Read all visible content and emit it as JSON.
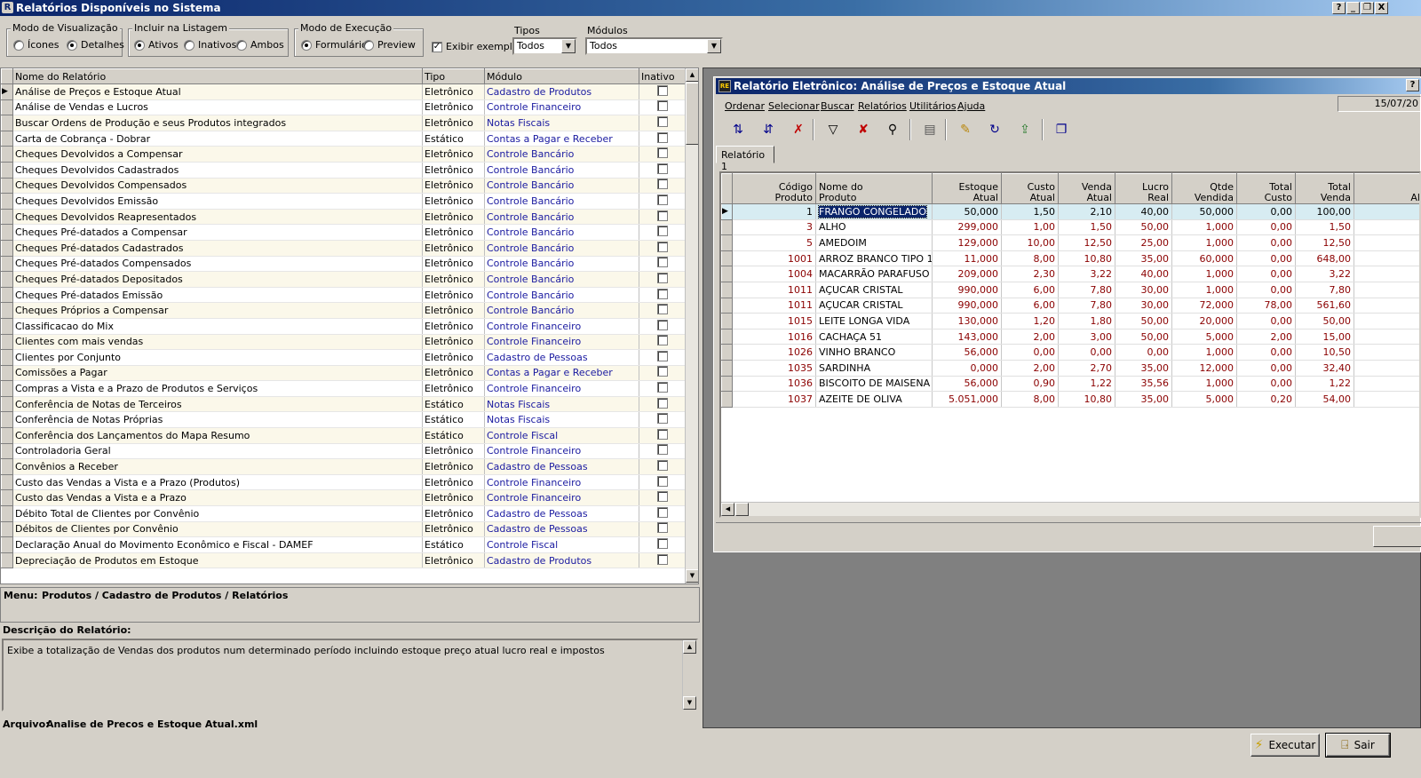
{
  "window": {
    "title": "Relatórios Disponíveis no Sistema",
    "buttons": [
      "?",
      "_",
      "❐",
      "X"
    ]
  },
  "toolbar": {
    "view_mode": {
      "label": "Modo de Visualização",
      "options": [
        "Ícones",
        "Detalhes"
      ],
      "selected": "Detalhes"
    },
    "include": {
      "label": "Incluir na Listagem",
      "options": [
        "Ativos",
        "Inativos",
        "Ambos"
      ],
      "selected": "Ativos"
    },
    "exec_mode": {
      "label": "Modo de Execução",
      "options": [
        "Formulário",
        "Preview"
      ],
      "selected": "Formulário"
    },
    "show_example": {
      "label": "Exibir exemplo",
      "checked": true
    },
    "types": {
      "label": "Tipos",
      "value": "Todos"
    },
    "modules": {
      "label": "Módulos",
      "value": "Todos"
    }
  },
  "report_list": {
    "columns": [
      "Nome do Relatório",
      "Tipo",
      "Módulo",
      "Inativo"
    ],
    "rows": [
      [
        "Análise de Preços e Estoque Atual",
        "Eletrônico",
        "Cadastro de Produtos"
      ],
      [
        "Análise de Vendas e Lucros",
        "Eletrônico",
        "Controle Financeiro"
      ],
      [
        "Buscar Ordens de Produção e seus Produtos integrados",
        "Eletrônico",
        "Notas Fiscais"
      ],
      [
        "Carta de Cobrança - Dobrar",
        "Estático",
        "Contas a Pagar e Receber"
      ],
      [
        "Cheques Devolvidos a Compensar",
        "Eletrônico",
        "Controle Bancário"
      ],
      [
        "Cheques Devolvidos Cadastrados",
        "Eletrônico",
        "Controle Bancário"
      ],
      [
        "Cheques Devolvidos Compensados",
        "Eletrônico",
        "Controle Bancário"
      ],
      [
        "Cheques Devolvidos Emissão",
        "Eletrônico",
        "Controle Bancário"
      ],
      [
        "Cheques Devolvidos Reapresentados",
        "Eletrônico",
        "Controle Bancário"
      ],
      [
        "Cheques Pré-datados a Compensar",
        "Eletrônico",
        "Controle Bancário"
      ],
      [
        "Cheques Pré-datados Cadastrados",
        "Eletrônico",
        "Controle Bancário"
      ],
      [
        "Cheques Pré-datados Compensados",
        "Eletrônico",
        "Controle Bancário"
      ],
      [
        "Cheques Pré-datados Depositados",
        "Eletrônico",
        "Controle Bancário"
      ],
      [
        "Cheques Pré-datados Emissão",
        "Eletrônico",
        "Controle Bancário"
      ],
      [
        "Cheques Próprios a Compensar",
        "Eletrônico",
        "Controle Bancário"
      ],
      [
        "Classificacao do Mix",
        "Eletrônico",
        "Controle Financeiro"
      ],
      [
        "Clientes com mais vendas",
        "Eletrônico",
        "Controle Financeiro"
      ],
      [
        "Clientes por Conjunto",
        "Eletrônico",
        "Cadastro de Pessoas"
      ],
      [
        "Comissões a Pagar",
        "Eletrônico",
        "Contas a Pagar e Receber"
      ],
      [
        "Compras a Vista e a Prazo de Produtos e Serviços",
        "Eletrônico",
        "Controle Financeiro"
      ],
      [
        "Conferência de Notas de Terceiros",
        "Estático",
        "Notas Fiscais"
      ],
      [
        "Conferência de Notas Próprias",
        "Estático",
        "Notas Fiscais"
      ],
      [
        "Conferência dos Lançamentos do Mapa Resumo",
        "Estático",
        "Controle Fiscal"
      ],
      [
        "Controladoria Geral",
        "Eletrônico",
        "Controle Financeiro"
      ],
      [
        "Convênios a Receber",
        "Eletrônico",
        "Cadastro de Pessoas"
      ],
      [
        "Custo das Vendas a Vista e a Prazo (Produtos)",
        "Eletrônico",
        "Controle Financeiro"
      ],
      [
        "Custo das Vendas a Vista e a Prazo",
        "Eletrônico",
        "Controle Financeiro"
      ],
      [
        "Débito Total de Clientes por Convênio",
        "Eletrônico",
        "Cadastro de Pessoas"
      ],
      [
        "Débitos de Clientes por Convênio",
        "Eletrônico",
        "Cadastro de Pessoas"
      ],
      [
        "Declaração Anual do Movimento Econômico e Fiscal - DAMEF",
        "Estático",
        "Controle Fiscal"
      ],
      [
        "Depreciação de Produtos em Estoque",
        "Eletrônico",
        "Cadastro de Produtos"
      ]
    ]
  },
  "menu_path": {
    "label": "Menu:",
    "value": "Produtos / Cadastro de Produtos / Relatórios"
  },
  "description": {
    "label": "Descrição do Relatório:",
    "text": "Exibe a totalização de Vendas dos produtos num determinado período incluindo estoque preço atual lucro real e impostos"
  },
  "file": {
    "label": "Arquivo:",
    "value": "Analise de Precos e Estoque Atual.xml"
  },
  "preview": {
    "title": "Relatório Eletrônico: Análise de Preços e Estoque Atual",
    "help": "?",
    "date": "15/07/20",
    "menu": [
      "Ordenar",
      "Selecionar",
      "Buscar",
      "Relatórios",
      "Utilitários",
      "Ajuda"
    ],
    "tab": "Relatório 1",
    "icons": [
      "sort-asc-icon",
      "sort-desc-icon",
      "clear-sort-icon",
      "filter-icon",
      "clear-filter-icon",
      "binoculars-icon",
      "columns-icon",
      "edit-icon",
      "refresh-icon",
      "export-icon",
      "windows-icon"
    ],
    "columns": [
      [
        "Código",
        "Produto"
      ],
      [
        "Nome do",
        "Produto"
      ],
      [
        "Estoque",
        "Atual"
      ],
      [
        "Custo",
        "Atual"
      ],
      [
        "Venda",
        "Atual"
      ],
      [
        "Lucro",
        "Real"
      ],
      [
        "Qtde",
        "Vendida"
      ],
      [
        "Total",
        "Custo"
      ],
      [
        "Total",
        "Venda"
      ],
      [
        "Al",
        ""
      ]
    ],
    "rows": [
      [
        "1",
        "FRANGO CONGELADO",
        "50,000",
        "1,50",
        "2,10",
        "40,00",
        "50,000",
        "0,00",
        "100,00"
      ],
      [
        "3",
        "ALHO",
        "299,000",
        "1,00",
        "1,50",
        "50,00",
        "1,000",
        "0,00",
        "1,50"
      ],
      [
        "5",
        "AMEDOIM",
        "129,000",
        "10,00",
        "12,50",
        "25,00",
        "1,000",
        "0,00",
        "12,50"
      ],
      [
        "1001",
        "ARROZ BRANCO TIPO 1",
        "11,000",
        "8,00",
        "10,80",
        "35,00",
        "60,000",
        "0,00",
        "648,00"
      ],
      [
        "1004",
        "MACARRÃO PARAFUSO",
        "209,000",
        "2,30",
        "3,22",
        "40,00",
        "1,000",
        "0,00",
        "3,22"
      ],
      [
        "1011",
        "AÇUCAR CRISTAL",
        "990,000",
        "6,00",
        "7,80",
        "30,00",
        "1,000",
        "0,00",
        "7,80"
      ],
      [
        "1011",
        "AÇUCAR CRISTAL",
        "990,000",
        "6,00",
        "7,80",
        "30,00",
        "72,000",
        "78,00",
        "561,60"
      ],
      [
        "1015",
        "LEITE LONGA VIDA",
        "130,000",
        "1,20",
        "1,80",
        "50,00",
        "20,000",
        "0,00",
        "50,00"
      ],
      [
        "1016",
        "CACHAÇA 51",
        "143,000",
        "2,00",
        "3,00",
        "50,00",
        "5,000",
        "2,00",
        "15,00"
      ],
      [
        "1026",
        "VINHO BRANCO",
        "56,000",
        "0,00",
        "0,00",
        "0,00",
        "1,000",
        "0,00",
        "10,50"
      ],
      [
        "1035",
        "SARDINHA",
        "0,000",
        "2,00",
        "2,70",
        "35,00",
        "12,000",
        "0,00",
        "32,40"
      ],
      [
        "1036",
        "BISCOITO DE MAISENA",
        "56,000",
        "0,90",
        "1,22",
        "35,56",
        "1,000",
        "0,00",
        "1,22"
      ],
      [
        "1037",
        "AZEITE DE OLIVA",
        "5.051,000",
        "8,00",
        "10,80",
        "35,00",
        "5,000",
        "0,20",
        "54,00"
      ]
    ]
  },
  "buttons": {
    "execute": "Executar",
    "exit": "Sair"
  }
}
